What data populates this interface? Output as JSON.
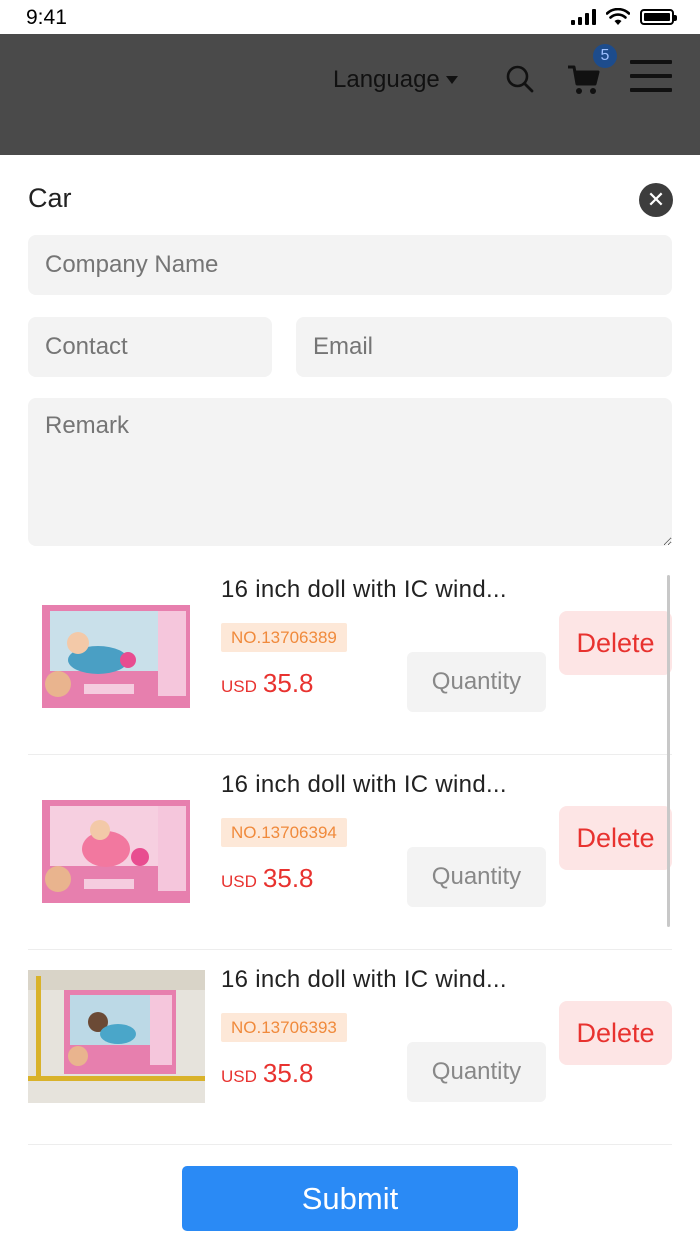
{
  "status_bar": {
    "time": "9:41"
  },
  "header": {
    "language_label": "Language",
    "cart_count": "5",
    "search_icon": "search-icon",
    "cart_icon": "cart-icon",
    "menu_icon": "menu-icon"
  },
  "panel": {
    "title": "Car",
    "close_icon": "close-icon"
  },
  "form": {
    "company_placeholder": "Company Name",
    "contact_placeholder": "Contact",
    "email_placeholder": "Email",
    "remark_placeholder": "Remark"
  },
  "items": [
    {
      "name": "16 inch doll with IC wind...",
      "no": "NO.13706389",
      "currency": "USD",
      "price": "35.8",
      "quantity_label": "Quantity",
      "delete_label": "Delete"
    },
    {
      "name": "16 inch doll with IC wind...",
      "no": "NO.13706394",
      "currency": "USD",
      "price": "35.8",
      "quantity_label": "Quantity",
      "delete_label": "Delete"
    },
    {
      "name": "16 inch doll with IC wind...",
      "no": "NO.13706393",
      "currency": "USD",
      "price": "35.8",
      "quantity_label": "Quantity",
      "delete_label": "Delete"
    }
  ],
  "submit_label": "Submit",
  "colors": {
    "header_bg": "#4a4a4a",
    "price": "#e8322f",
    "delete_bg": "#fde5e5",
    "badge_bg": "#1d4c8c",
    "submit_bg": "#2a8af5",
    "item_no_bg": "#fde8d8",
    "item_no_text": "#f08a3c"
  }
}
